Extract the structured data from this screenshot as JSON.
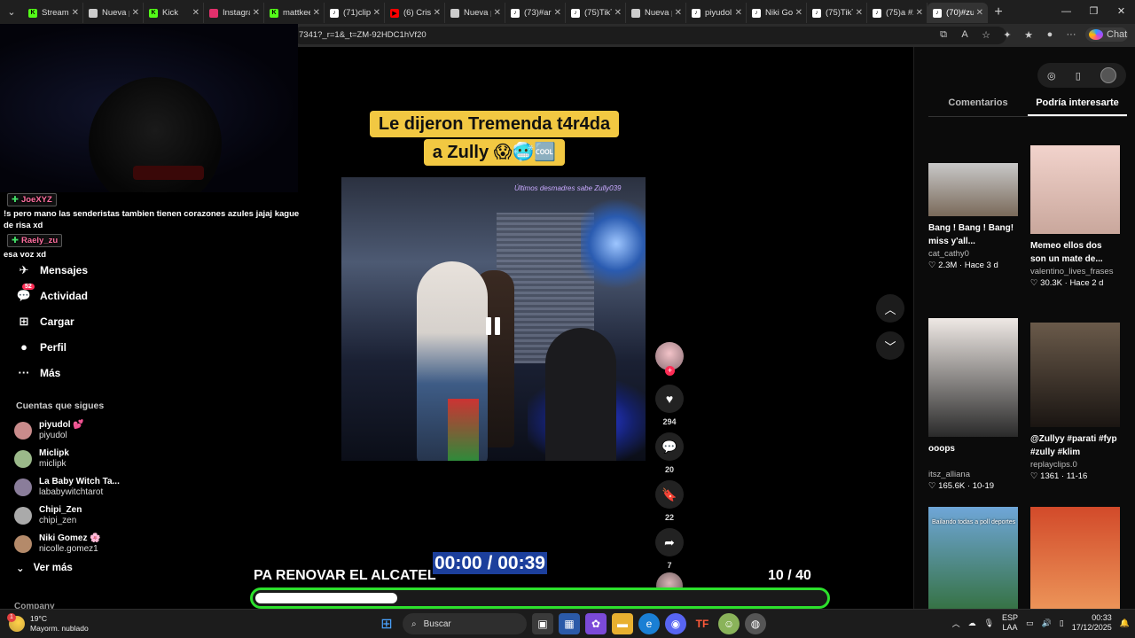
{
  "browser": {
    "tabs": [
      {
        "label": "Stream",
        "fav_color": "#53fc18",
        "fav_text": "K"
      },
      {
        "label": "Nueva p",
        "fav_color": "#cccccc",
        "fav_text": ""
      },
      {
        "label": "Kick",
        "fav_color": "#53fc18",
        "fav_text": "K"
      },
      {
        "label": "Instagra",
        "fav_color": "#e1306c",
        "fav_text": ""
      },
      {
        "label": "mattkee",
        "fav_color": "#53fc18",
        "fav_text": "K"
      },
      {
        "label": "(71)clip",
        "fav_color": "#ffffff",
        "fav_text": "♪"
      },
      {
        "label": "(6) Crist",
        "fav_color": "#ff0000",
        "fav_text": "▶"
      },
      {
        "label": "Nueva p",
        "fav_color": "#cccccc",
        "fav_text": ""
      },
      {
        "label": "(73)#ari",
        "fav_color": "#ffffff",
        "fav_text": "♪"
      },
      {
        "label": "(75)TikT",
        "fav_color": "#ffffff",
        "fav_text": "♪"
      },
      {
        "label": "Nueva p",
        "fav_color": "#cccccc",
        "fav_text": ""
      },
      {
        "label": "piyudol",
        "fav_color": "#ffffff",
        "fav_text": "♪"
      },
      {
        "label": "Niki Gor",
        "fav_color": "#ffffff",
        "fav_text": "♪"
      },
      {
        "label": "(75)TikT",
        "fav_color": "#ffffff",
        "fav_text": "♪"
      },
      {
        "label": "(75)a #z",
        "fav_color": "#ffffff",
        "fav_text": "♪"
      },
      {
        "label": "(70)#zul",
        "fav_color": "#ffffff",
        "fav_text": "♪"
      }
    ],
    "url": "7341?_r=1&_t=ZM-92HDC1hVf20",
    "chat_label": "Chat"
  },
  "stream_overlay": {
    "chat": [
      {
        "user": "JoeXYZ",
        "message": "!s pero mano las senderistas tambien tienen corazones azules jajaj kague de risa xd"
      },
      {
        "user": "Raely_zu",
        "message": "esa voz xd"
      }
    ],
    "timer": "00:00 / 00:39",
    "caption": "PA RENOVAR EL ALCATEL",
    "count": "10  / 40",
    "goal_progress": 0.25
  },
  "nav": {
    "items": [
      {
        "label": "Mensajes",
        "icon": "✈",
        "badge": ""
      },
      {
        "label": "Actividad",
        "icon": "💬",
        "badge": "52"
      },
      {
        "label": "Cargar",
        "icon": "⊞",
        "badge": ""
      },
      {
        "label": "Perfil",
        "icon": "●",
        "badge": ""
      },
      {
        "label": "Más",
        "icon": "···",
        "badge": ""
      }
    ],
    "following_title": "Cuentas que sigues",
    "following": [
      {
        "name": "piyudol 💕",
        "handle": "piyudol",
        "color": "#c98b8b"
      },
      {
        "name": "Miclipk",
        "handle": "miclipk",
        "color": "#9bb98a"
      },
      {
        "name": "La Baby Witch Ta...",
        "handle": "lababywitchtarot",
        "color": "#8a7d9a"
      },
      {
        "name": "Chipi_Zen",
        "handle": "chipi_zen",
        "color": "#aaaaaa"
      },
      {
        "name": "Niki Gomez 🌸",
        "handle": "nicolle.gomez1",
        "color": "#b48a6a"
      }
    ],
    "see_more": "Ver más",
    "company": "Company"
  },
  "video": {
    "title_line1": "Le dijeron Tremenda t4r4da",
    "title_line2": "a Zully 😱🥶🆒",
    "watermark": "Últimos desmadres sabe Zully039",
    "counts": {
      "likes": "294",
      "comments": "20",
      "saves": "22",
      "shares": "7"
    }
  },
  "right_panel": {
    "tabs": [
      "Comentarios",
      "Podría interesarte"
    ],
    "active_tab": 1,
    "cards": [
      {
        "title": "Bang ! Bang ! Bang! miss y'all...",
        "user": "cat_cathy0",
        "likes": "2.3M",
        "age": "Hace 3 d",
        "color1": "#c8c8c8",
        "color2": "#7a6a5a"
      },
      {
        "title": "Memeo ellos dos son un mate de...",
        "user": "valentino_lives_frases",
        "likes": "30.3K",
        "age": "Hace 2 d",
        "color1": "#f2d3cc",
        "color2": "#c9a79c"
      },
      {
        "title": "ooops",
        "user": "itsz_alliana",
        "likes": "165.6K",
        "age": "10-19",
        "color1": "#efe9e5",
        "color2": "#2a2a2a"
      },
      {
        "title": "@Zullyy #parati #fyp #zully #klim",
        "user": "replayclips.0",
        "likes": "1361",
        "age": "11-16",
        "color1": "#6a5a4a",
        "color2": "#1a1512"
      },
      {
        "title": "",
        "user": "",
        "likes": "",
        "age": "",
        "color1": "#6fa6d8",
        "color2": "#2d6a2d",
        "overlay": "Bailando todas a poll deportes"
      },
      {
        "title": "",
        "user": "",
        "likes": "",
        "age": "",
        "color1": "#d24a2a",
        "color2": "#f0a060",
        "overlay": ""
      }
    ]
  },
  "taskbar": {
    "temp": "19°C",
    "weather": "Mayorm. nublado",
    "search_placeholder": "Buscar",
    "lang1": "ESP",
    "lang2": "LAA",
    "time": "00:33",
    "date": "17/12/2025"
  }
}
